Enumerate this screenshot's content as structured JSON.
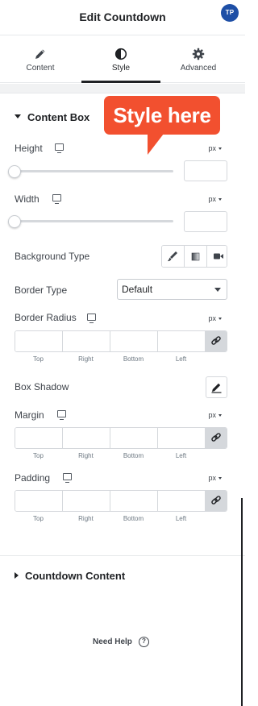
{
  "header": {
    "title": "Edit Countdown",
    "avatar_initials": "TP"
  },
  "tabs": [
    {
      "label": "Content",
      "icon": "pencil-icon",
      "active": false
    },
    {
      "label": "Style",
      "icon": "contrast-icon",
      "active": true
    },
    {
      "label": "Advanced",
      "icon": "gear-icon",
      "active": false
    }
  ],
  "callout": {
    "text": "Style here",
    "color": "#f2502f"
  },
  "content_box": {
    "title": "Content Box",
    "height": {
      "label": "Height",
      "unit": "px",
      "value": ""
    },
    "width": {
      "label": "Width",
      "unit": "px",
      "value": ""
    },
    "background_type": {
      "label": "Background Type",
      "options": [
        "classic-brush-icon",
        "gradient-icon",
        "video-icon"
      ]
    },
    "border_type": {
      "label": "Border Type",
      "selected": "Default"
    },
    "border_radius": {
      "label": "Border Radius",
      "unit": "px",
      "sides": [
        "Top",
        "Right",
        "Bottom",
        "Left"
      ]
    },
    "box_shadow": {
      "label": "Box Shadow"
    },
    "margin": {
      "label": "Margin",
      "unit": "px",
      "sides": [
        "Top",
        "Right",
        "Bottom",
        "Left"
      ]
    },
    "padding": {
      "label": "Padding",
      "unit": "px",
      "sides": [
        "Top",
        "Right",
        "Bottom",
        "Left"
      ]
    }
  },
  "countdown_content": {
    "title": "Countdown Content"
  },
  "footer": {
    "help_label": "Need Help",
    "help_icon": "?"
  }
}
